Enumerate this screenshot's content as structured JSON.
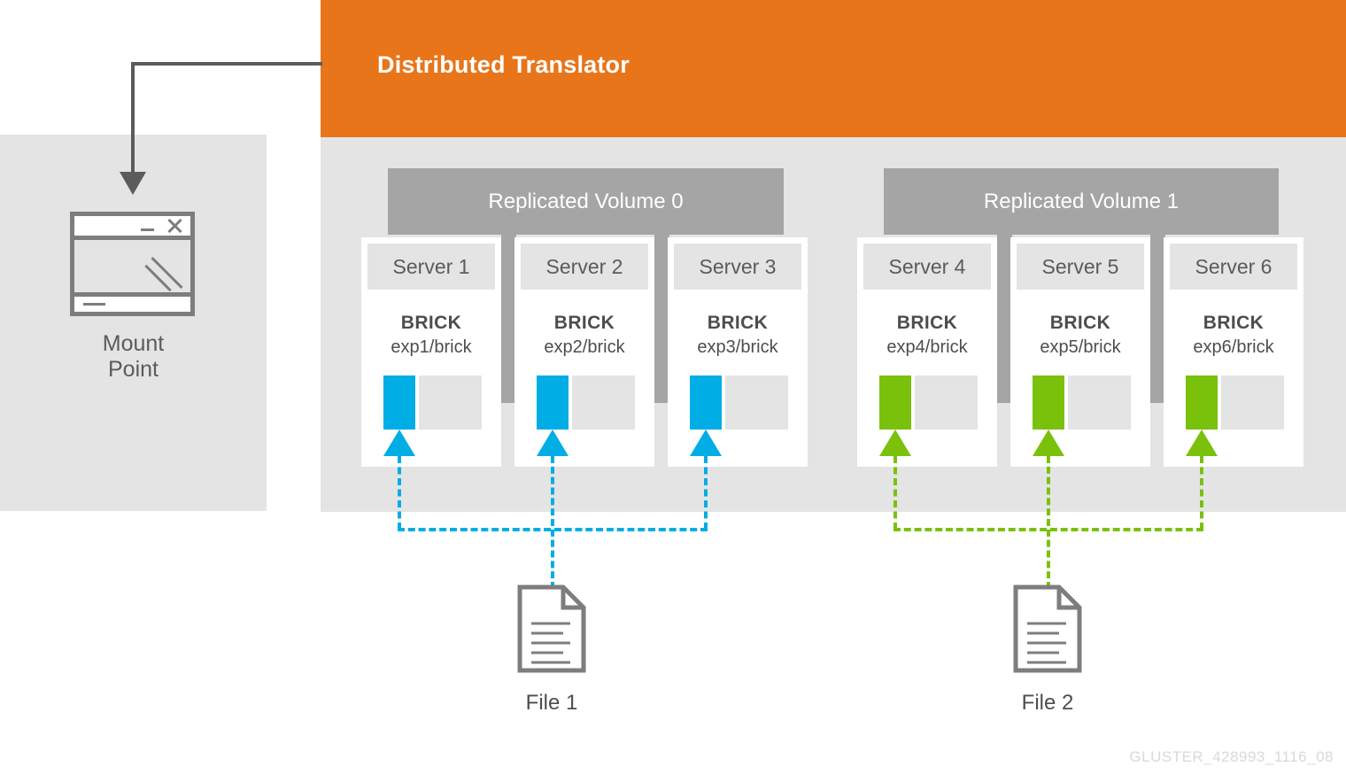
{
  "diagram": {
    "title": "Distributed Translator",
    "watermark": "GLUSTER_428993_1116_08"
  },
  "colors": {
    "orange": "#e8751a",
    "panel_gray": "#e4e4e4",
    "volume_gray": "#a5a5a5",
    "text_gray": "#4d4d4d",
    "cyan": "#00ade4",
    "green": "#7ac10c",
    "icon_gray": "#7d7d7d"
  },
  "mount_point": {
    "label": "Mount\nPoint",
    "label_line1": "Mount",
    "label_line2": "Point",
    "icon": "window-icon",
    "minimize_glyph": "_",
    "close_glyph": "×"
  },
  "volumes": [
    {
      "name": "Replicated Volume 0",
      "accent": "#00ade4",
      "servers": [
        {
          "name": "Server 1",
          "brick_label": "BRICK",
          "brick_path": "exp1/brick"
        },
        {
          "name": "Server 2",
          "brick_label": "BRICK",
          "brick_path": "exp2/brick"
        },
        {
          "name": "Server 3",
          "brick_label": "BRICK",
          "brick_path": "exp3/brick"
        }
      ]
    },
    {
      "name": "Replicated Volume 1",
      "accent": "#7ac10c",
      "servers": [
        {
          "name": "Server 4",
          "brick_label": "BRICK",
          "brick_path": "exp4/brick"
        },
        {
          "name": "Server 5",
          "brick_label": "BRICK",
          "brick_path": "exp5/brick"
        },
        {
          "name": "Server 6",
          "brick_label": "BRICK",
          "brick_path": "exp6/brick"
        }
      ]
    }
  ],
  "files": [
    {
      "label": "File 1",
      "accent": "#00ade4",
      "targets": [
        "Server 1",
        "Server 2",
        "Server 3"
      ]
    },
    {
      "label": "File 2",
      "accent": "#7ac10c",
      "targets": [
        "Server 4",
        "Server 5",
        "Server 6"
      ]
    }
  ]
}
